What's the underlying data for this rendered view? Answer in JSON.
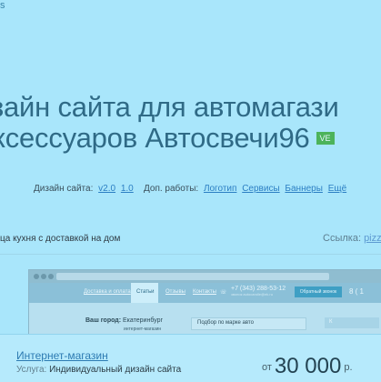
{
  "top_text": "s",
  "title": {
    "line1": "зайн сайта для автомагази",
    "line2": "ксессуаров Автосвечи96",
    "badge": "VE"
  },
  "design": {
    "label": "Дизайн сайта:",
    "v1": "v2.0",
    "v2": "1.0"
  },
  "extra": {
    "label": "Доп. работы:",
    "items": [
      "Логотип",
      "Сервисы",
      "Баннеры",
      "Ещё"
    ]
  },
  "description": "ца кухня с доставкой на дом",
  "link": {
    "label": "Ссылка:",
    "value": "pizz"
  },
  "shot": {
    "nav": [
      "Доставка и оплата",
      "Статьи",
      "Отзывы",
      "Контакты"
    ],
    "phone": "+7 (343) 288-53-12",
    "phone_sub": "звонок  autocandle@ek.ru",
    "callback": "Обратный звонок",
    "time": "8 ( 1",
    "city_label": "Ваш город:",
    "city": "Екатеринбург",
    "small": "интернет-магазин",
    "panel": "Подбор по марке авто",
    "panel2": "К"
  },
  "footer": {
    "title": "Интернет-магазин",
    "service_label": "Услуга:",
    "service": "Индивидуальный дизайн сайта",
    "price_prefix": "от",
    "price": "30 000",
    "price_suffix": "р."
  }
}
